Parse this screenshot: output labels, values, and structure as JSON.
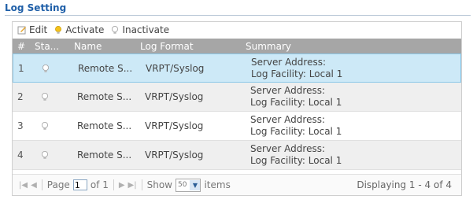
{
  "section": {
    "title": "Log Setting"
  },
  "toolbar": {
    "edit": "Edit",
    "activate": "Activate",
    "inactivate": "Inactivate"
  },
  "columns": {
    "num": "#",
    "status": "Sta...",
    "name": "Name",
    "format": "Log Format",
    "summary": "Summary"
  },
  "rows": [
    {
      "num": "1",
      "name": "Remote S...",
      "format": "VRPT/Syslog",
      "summary1": "Server Address:",
      "summary2": "Log Facility: Local 1"
    },
    {
      "num": "2",
      "name": "Remote S...",
      "format": "VRPT/Syslog",
      "summary1": "Server Address:",
      "summary2": "Log Facility: Local 1"
    },
    {
      "num": "3",
      "name": "Remote S...",
      "format": "VRPT/Syslog",
      "summary1": "Server Address:",
      "summary2": "Log Facility: Local 1"
    },
    {
      "num": "4",
      "name": "Remote S...",
      "format": "VRPT/Syslog",
      "summary1": "Server Address:",
      "summary2": "Log Facility: Local 1"
    }
  ],
  "pager": {
    "page_label": "Page",
    "page_value": "1",
    "of_label": "of 1",
    "show_label": "Show",
    "show_value": "50",
    "items_label": "items",
    "displaying": "Displaying 1 - 4 of 4"
  },
  "colors": {
    "title": "#1f5fa8",
    "header_bg": "#a6a6a6",
    "selected_row": "#cde9f7"
  }
}
